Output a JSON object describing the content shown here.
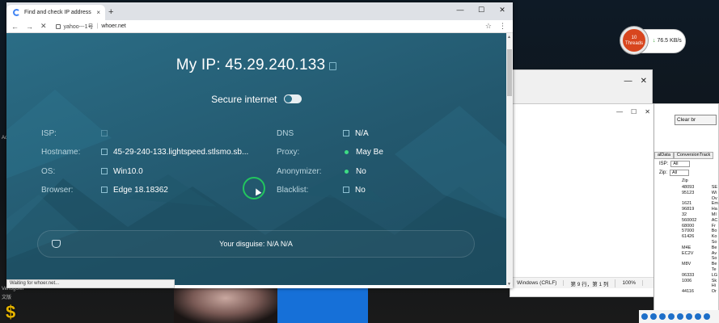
{
  "browser": {
    "tab_title": "Find and check IP address",
    "tab_close": "×",
    "new_tab": "+",
    "win_minimize": "—",
    "win_maximize": "☐",
    "win_close": "✕",
    "nav_back": "←",
    "nav_forward": "→",
    "nav_reload": "✕",
    "omnibox_prefix": "yahoo---1号",
    "omnibox_sep": "|",
    "url": "whoer.net",
    "star": "☆",
    "menu": "⋮",
    "status": "Waiting for whoer.net..."
  },
  "page": {
    "my_ip_label": "My IP: 45.29.240.133",
    "secure_label": "Secure internet",
    "left": [
      {
        "label": "ISP:",
        "value": ""
      },
      {
        "label": "Hostname:",
        "value": "45-29-240-133.lightspeed.stlsmo.sb..."
      },
      {
        "label": "OS:",
        "value": "Win10.0"
      },
      {
        "label": "Browser:",
        "value": "Edge 18.18362"
      }
    ],
    "right": [
      {
        "label": "DNS",
        "value": "N/A"
      },
      {
        "label": "Proxy:",
        "value": "May Be"
      },
      {
        "label": "Anonymizer:",
        "value": "No"
      },
      {
        "label": "Blacklist:",
        "value": "No"
      }
    ],
    "disguise": "Your disguise: N/A  N/A"
  },
  "speed_widget": {
    "threads_count": "10",
    "threads_label": "Threads",
    "rate": "76.5 KB/s",
    "arrow": "↓"
  },
  "background_windows": {
    "clear_button": "Clear br",
    "tab1": "alData",
    "tab2": "ConversionTrack",
    "filter1_label": "ISP:",
    "filter1_value": "All",
    "filter2_label": "Zip:",
    "filter2_value": "All",
    "col_zip_header": "Zip",
    "col_is_header": "IS",
    "zip_values": [
      "48093",
      "95123",
      "",
      "1621",
      "96819",
      "32",
      "560002",
      "68000",
      "57000",
      "61426",
      "",
      "M4E",
      "EC2V",
      "",
      "M8V",
      "",
      "06333",
      "1006",
      "",
      "44116"
    ],
    "is_values": [
      "SE",
      "Wi",
      "Ov",
      "Em",
      "Ha",
      "MI",
      "AC",
      "Fr",
      "Bo",
      "Ko",
      "So",
      "Be",
      "Av",
      "So",
      "Be",
      "Te",
      "LG",
      "Sk",
      "Hi",
      "Or"
    ],
    "notepad_status_eol": "Windows (CRLF)",
    "notepad_status_pos": "第 9 行，第 1 列",
    "notepad_status_zoom": "100%",
    "win_min": "—",
    "win_max": "☐",
    "win_close": "✕"
  },
  "desktop": {
    "left_text_1": "Ad",
    "left_text_2": "Vertogofer",
    "left_text_3": "文版",
    "dollar": "$"
  }
}
